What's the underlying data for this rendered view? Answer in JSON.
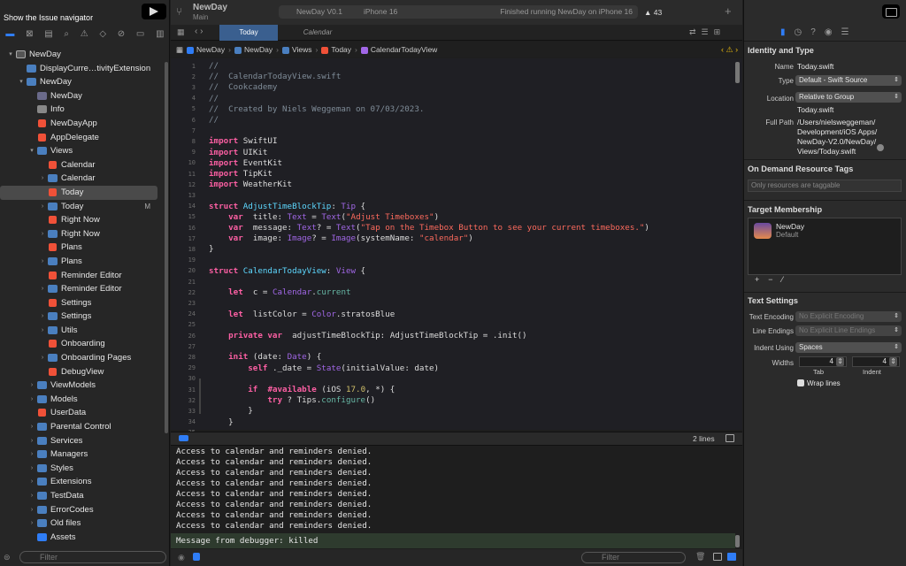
{
  "window": {
    "tooltip": "Show the Issue navigator"
  },
  "toolbar": {
    "project_name": "NewDay",
    "project_sub": "Main",
    "scheme": "NewDay V0.1",
    "destination": "iPhone 16",
    "status": "Finished running NewDay on iPhone 16",
    "warnings": "▲ 43"
  },
  "tabs": [
    {
      "label": "Today"
    },
    {
      "label": "Calendar"
    }
  ],
  "breadcrumb": [
    "NewDay",
    "NewDay",
    "Views",
    "Today",
    "CalendarTodayView"
  ],
  "navigator": {
    "items": [
      {
        "label": "NewDay",
        "depth": 0,
        "icon": "app",
        "chev": "▾"
      },
      {
        "label": "DisplayCurre…tivityExtension",
        "depth": 1,
        "icon": "folder",
        "chev": ""
      },
      {
        "label": "NewDay",
        "depth": 1,
        "icon": "folder",
        "chev": "▾"
      },
      {
        "label": "NewDay",
        "depth": 2,
        "icon": "target",
        "chev": ""
      },
      {
        "label": "Info",
        "depth": 2,
        "icon": "doc",
        "chev": ""
      },
      {
        "label": "NewDayApp",
        "depth": 2,
        "icon": "swift",
        "chev": ""
      },
      {
        "label": "AppDelegate",
        "depth": 2,
        "icon": "swift",
        "chev": ""
      },
      {
        "label": "Views",
        "depth": 2,
        "icon": "folder",
        "chev": "▾"
      },
      {
        "label": "Calendar",
        "depth": 3,
        "icon": "swift",
        "chev": ""
      },
      {
        "label": "Calendar",
        "depth": 3,
        "icon": "folder",
        "chev": "›"
      },
      {
        "label": "Today",
        "depth": 3,
        "icon": "swift",
        "chev": "",
        "selected": true
      },
      {
        "label": "Today",
        "depth": 3,
        "icon": "folder",
        "chev": "›",
        "badge": "M"
      },
      {
        "label": "Right Now",
        "depth": 3,
        "icon": "swift",
        "chev": ""
      },
      {
        "label": "Right Now",
        "depth": 3,
        "icon": "folder",
        "chev": "›"
      },
      {
        "label": "Plans",
        "depth": 3,
        "icon": "swift",
        "chev": ""
      },
      {
        "label": "Plans",
        "depth": 3,
        "icon": "folder",
        "chev": "›"
      },
      {
        "label": "Reminder Editor",
        "depth": 3,
        "icon": "swift",
        "chev": ""
      },
      {
        "label": "Reminder Editor",
        "depth": 3,
        "icon": "folder",
        "chev": "›"
      },
      {
        "label": "Settings",
        "depth": 3,
        "icon": "swift",
        "chev": ""
      },
      {
        "label": "Settings",
        "depth": 3,
        "icon": "folder",
        "chev": "›"
      },
      {
        "label": "Utils",
        "depth": 3,
        "icon": "folder",
        "chev": "›"
      },
      {
        "label": "Onboarding",
        "depth": 3,
        "icon": "swift",
        "chev": ""
      },
      {
        "label": "Onboarding Pages",
        "depth": 3,
        "icon": "folder",
        "chev": "›"
      },
      {
        "label": "DebugView",
        "depth": 3,
        "icon": "swift",
        "chev": ""
      },
      {
        "label": "ViewModels",
        "depth": 2,
        "icon": "folder",
        "chev": "›"
      },
      {
        "label": "Models",
        "depth": 2,
        "icon": "folder",
        "chev": "›"
      },
      {
        "label": "UserData",
        "depth": 2,
        "icon": "swift",
        "chev": ""
      },
      {
        "label": "Parental Control",
        "depth": 2,
        "icon": "folder",
        "chev": "›"
      },
      {
        "label": "Services",
        "depth": 2,
        "icon": "folder",
        "chev": "›"
      },
      {
        "label": "Managers",
        "depth": 2,
        "icon": "folder",
        "chev": "›"
      },
      {
        "label": "Styles",
        "depth": 2,
        "icon": "folder",
        "chev": "›"
      },
      {
        "label": "Extensions",
        "depth": 2,
        "icon": "folder",
        "chev": "›"
      },
      {
        "label": "TestData",
        "depth": 2,
        "icon": "folder",
        "chev": "›"
      },
      {
        "label": "ErrorCodes",
        "depth": 2,
        "icon": "folder",
        "chev": "›"
      },
      {
        "label": "Old files",
        "depth": 2,
        "icon": "folder",
        "chev": "›"
      },
      {
        "label": "Assets",
        "depth": 2,
        "icon": "asset",
        "chev": ""
      }
    ],
    "filter_placeholder": "Filter"
  },
  "code": {
    "line_numbers": [
      "1",
      "2",
      "3",
      "4",
      "5",
      "6",
      "7",
      "8",
      "9",
      "10",
      "11",
      "12",
      "13",
      "14",
      "15",
      "16",
      "17",
      "18",
      "19",
      "20",
      "21",
      "22",
      "23",
      "24",
      "25",
      "26",
      "27",
      "28",
      "29",
      "30",
      "31",
      "32",
      "33",
      "34",
      "35"
    ],
    "lines": [
      [
        [
          "cm",
          "//"
        ]
      ],
      [
        [
          "cm",
          "//  CalendarTodayView.swift"
        ]
      ],
      [
        [
          "cm",
          "//  Cookcademy"
        ]
      ],
      [
        [
          "cm",
          "//"
        ]
      ],
      [
        [
          "cm",
          "//  Created by Niels Weggeman on 07/03/2023."
        ]
      ],
      [
        [
          "cm",
          "//"
        ]
      ],
      [],
      [
        [
          "kw",
          "import"
        ],
        [
          "",
          "SwiftUI"
        ]
      ],
      [
        [
          "kw",
          "import"
        ],
        [
          "",
          "UIKit"
        ]
      ],
      [
        [
          "kw",
          "import"
        ],
        [
          "",
          "EventKit"
        ]
      ],
      [
        [
          "kw",
          "import"
        ],
        [
          "",
          "TipKit"
        ]
      ],
      [
        [
          "kw",
          "import"
        ],
        [
          "",
          "WeatherKit"
        ]
      ],
      [],
      [
        [
          "kw",
          "struct"
        ],
        [
          "ty",
          "AdjustTimeBlockTip"
        ],
        [
          "",
          ": "
        ],
        [
          "pr",
          "Tip"
        ],
        [
          "",
          " {"
        ]
      ],
      [
        [
          "",
          "    "
        ],
        [
          "kw",
          "var"
        ],
        [
          "",
          " title: "
        ],
        [
          "pr",
          "Text"
        ],
        [
          "",
          " = "
        ],
        [
          "pr",
          "Text"
        ],
        [
          "",
          "("
        ],
        [
          "st",
          "\"Adjust Timeboxes\""
        ],
        [
          "",
          ")"
        ]
      ],
      [
        [
          "",
          "    "
        ],
        [
          "kw",
          "var"
        ],
        [
          "",
          " message: "
        ],
        [
          "pr",
          "Text"
        ],
        [
          "",
          "? = "
        ],
        [
          "pr",
          "Text"
        ],
        [
          "",
          "("
        ],
        [
          "st",
          "\"Tap on the Timebox Button to see your current timeboxes.\""
        ],
        [
          "",
          ")"
        ]
      ],
      [
        [
          "",
          "    "
        ],
        [
          "kw",
          "var"
        ],
        [
          "",
          " image: "
        ],
        [
          "pr",
          "Image"
        ],
        [
          "",
          "? = "
        ],
        [
          "pr",
          "Image"
        ],
        [
          "",
          "(systemName: "
        ],
        [
          "st",
          "\"calendar\""
        ],
        [
          "",
          ")"
        ]
      ],
      [
        [
          "",
          "}"
        ]
      ],
      [],
      [
        [
          "kw",
          "struct"
        ],
        [
          "ty",
          "CalendarTodayView"
        ],
        [
          "",
          ": "
        ],
        [
          "pr",
          "View"
        ],
        [
          "",
          " {"
        ]
      ],
      [],
      [
        [
          "",
          "    "
        ],
        [
          "kw",
          "let"
        ],
        [
          "",
          " c = "
        ],
        [
          "pr",
          "Calendar"
        ],
        [
          "",
          "."
        ],
        [
          "fn",
          "current"
        ]
      ],
      [],
      [
        [
          "",
          "    "
        ],
        [
          "kw",
          "let"
        ],
        [
          "",
          " listColor = "
        ],
        [
          "pr",
          "Color"
        ],
        [
          "",
          ".stratosBlue"
        ]
      ],
      [],
      [
        [
          "",
          "    "
        ],
        [
          "kw",
          "private var"
        ],
        [
          "",
          " adjustTimeBlockTip: AdjustTimeBlockTip = .init()"
        ]
      ],
      [],
      [
        [
          "",
          "    "
        ],
        [
          "kw",
          "init"
        ],
        [
          "",
          "(date: "
        ],
        [
          "pr",
          "Date"
        ],
        [
          "",
          ") {"
        ]
      ],
      [
        [
          "",
          "        "
        ],
        [
          "kw",
          "self"
        ],
        [
          "",
          "._date = "
        ],
        [
          "pr",
          "State"
        ],
        [
          "",
          "(initialValue: date)"
        ]
      ],
      [],
      [
        [
          "",
          "        "
        ],
        [
          "kw",
          "if"
        ],
        [
          "",
          " "
        ],
        [
          "kw",
          "#available"
        ],
        [
          "",
          "(iOS "
        ],
        [
          "nm",
          "17.0"
        ],
        [
          "",
          ", *) {"
        ]
      ],
      [
        [
          "",
          "            "
        ],
        [
          "kw",
          "try"
        ],
        [
          "",
          "? Tips."
        ],
        [
          "fn",
          "configure"
        ],
        [
          "",
          "()"
        ]
      ],
      [
        [
          "",
          "        }"
        ]
      ],
      [
        [
          "",
          "    }"
        ]
      ],
      []
    ]
  },
  "debug": {
    "lines_label": "2 lines"
  },
  "console": {
    "lines": [
      "Access to calendar and reminders denied.",
      "Access to calendar and reminders denied.",
      "Access to calendar and reminders denied.",
      "Access to calendar and reminders denied.",
      "Access to calendar and reminders denied.",
      "Access to calendar and reminders denied.",
      "Access to calendar and reminders denied.",
      "Access to calendar and reminders denied."
    ],
    "killed": "Message from debugger: killed",
    "filter_placeholder": "Filter"
  },
  "inspector": {
    "identity_header": "Identity and Type",
    "name_label": "Name",
    "name_value": "Today.swift",
    "type_label": "Type",
    "type_value": "Default - Swift Source",
    "location_label": "Location",
    "location_value": "Relative to Group",
    "location_file": "Today.swift",
    "fullpath_label": "Full Path",
    "fullpath_value": "/Users/nielsweggeman/\nDevelopment/iOS Apps/\nNewDay-V2.0/NewDay/\nViews/Today.swift",
    "odr_header": "On Demand Resource Tags",
    "odr_placeholder": "Only resources are taggable",
    "tm_header": "Target Membership",
    "tm_name": "NewDay",
    "tm_sub": "Default",
    "text_header": "Text Settings",
    "encoding_label": "Text Encoding",
    "encoding_value": "No Explicit Encoding",
    "endings_label": "Line Endings",
    "endings_value": "No Explicit Line Endings",
    "indent_label": "Indent Using",
    "indent_value": "Spaces",
    "widths_label": "Widths",
    "tab_value": "4",
    "indent_width_value": "4",
    "tab_label": "Tab",
    "indent_label2": "Indent",
    "wrap_label": "Wrap lines"
  },
  "colors": {
    "accent": "#2f7df6",
    "swift": "#f05138",
    "selected_tab": "#3a5f8f"
  }
}
